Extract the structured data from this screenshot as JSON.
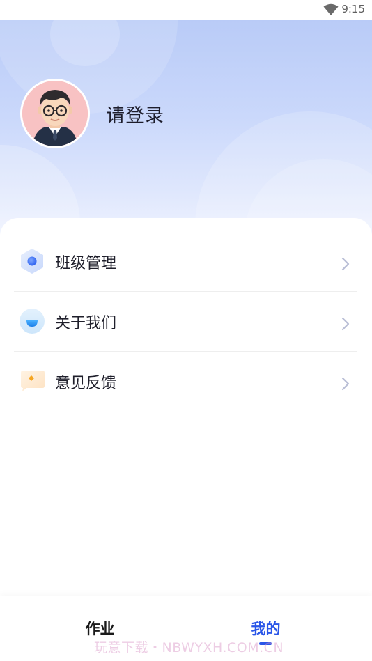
{
  "status_bar": {
    "time": "9:15",
    "wifi_icon": "wifi-icon"
  },
  "header": {
    "avatar_icon": "user-avatar",
    "login_text": "请登录"
  },
  "menu": {
    "items": [
      {
        "label": "班级管理",
        "icon": "hexagon-icon"
      },
      {
        "label": "关于我们",
        "icon": "bowl-circle-icon"
      },
      {
        "label": "意见反馈",
        "icon": "message-bubble-icon"
      }
    ]
  },
  "tabs": [
    {
      "label": "作业",
      "active": false
    },
    {
      "label": "我的",
      "active": true
    }
  ],
  "watermark": "玩意下载・NBWYXH.COM.CN",
  "colors": {
    "accent": "#2a56e8",
    "header_top": "#b9cbf7",
    "header_bottom": "#eef2fe",
    "text_primary": "#1f1f2b"
  }
}
